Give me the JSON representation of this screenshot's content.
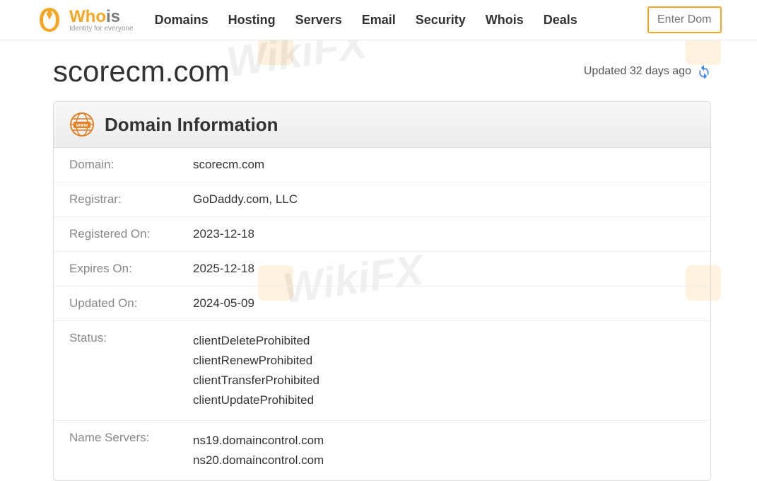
{
  "logo": {
    "main_who": "Who",
    "main_is": "is",
    "tagline": "Identity for everyone"
  },
  "nav": {
    "domains": "Domains",
    "hosting": "Hosting",
    "servers": "Servers",
    "email": "Email",
    "security": "Security",
    "whois": "Whois",
    "deals": "Deals"
  },
  "search": {
    "placeholder": "Enter Doma"
  },
  "domain_title": "scorecm.com",
  "updated_text": "Updated 32 days ago",
  "panel_title": "Domain Information",
  "info": {
    "domain_label": "Domain:",
    "domain_value": "scorecm.com",
    "registrar_label": "Registrar:",
    "registrar_value": "GoDaddy.com, LLC",
    "registered_label": "Registered On:",
    "registered_value": "2023-12-18",
    "expires_label": "Expires On:",
    "expires_value": "2025-12-18",
    "updated_label": "Updated On:",
    "updated_value": "2024-05-09",
    "status_label": "Status:",
    "status_values": [
      "clientDeleteProhibited",
      "clientRenewProhibited",
      "clientTransferProhibited",
      "clientUpdateProhibited"
    ],
    "ns_label": "Name Servers:",
    "ns_values": [
      "ns19.domaincontrol.com",
      "ns20.domaincontrol.com"
    ]
  },
  "watermark": "WikiFX"
}
